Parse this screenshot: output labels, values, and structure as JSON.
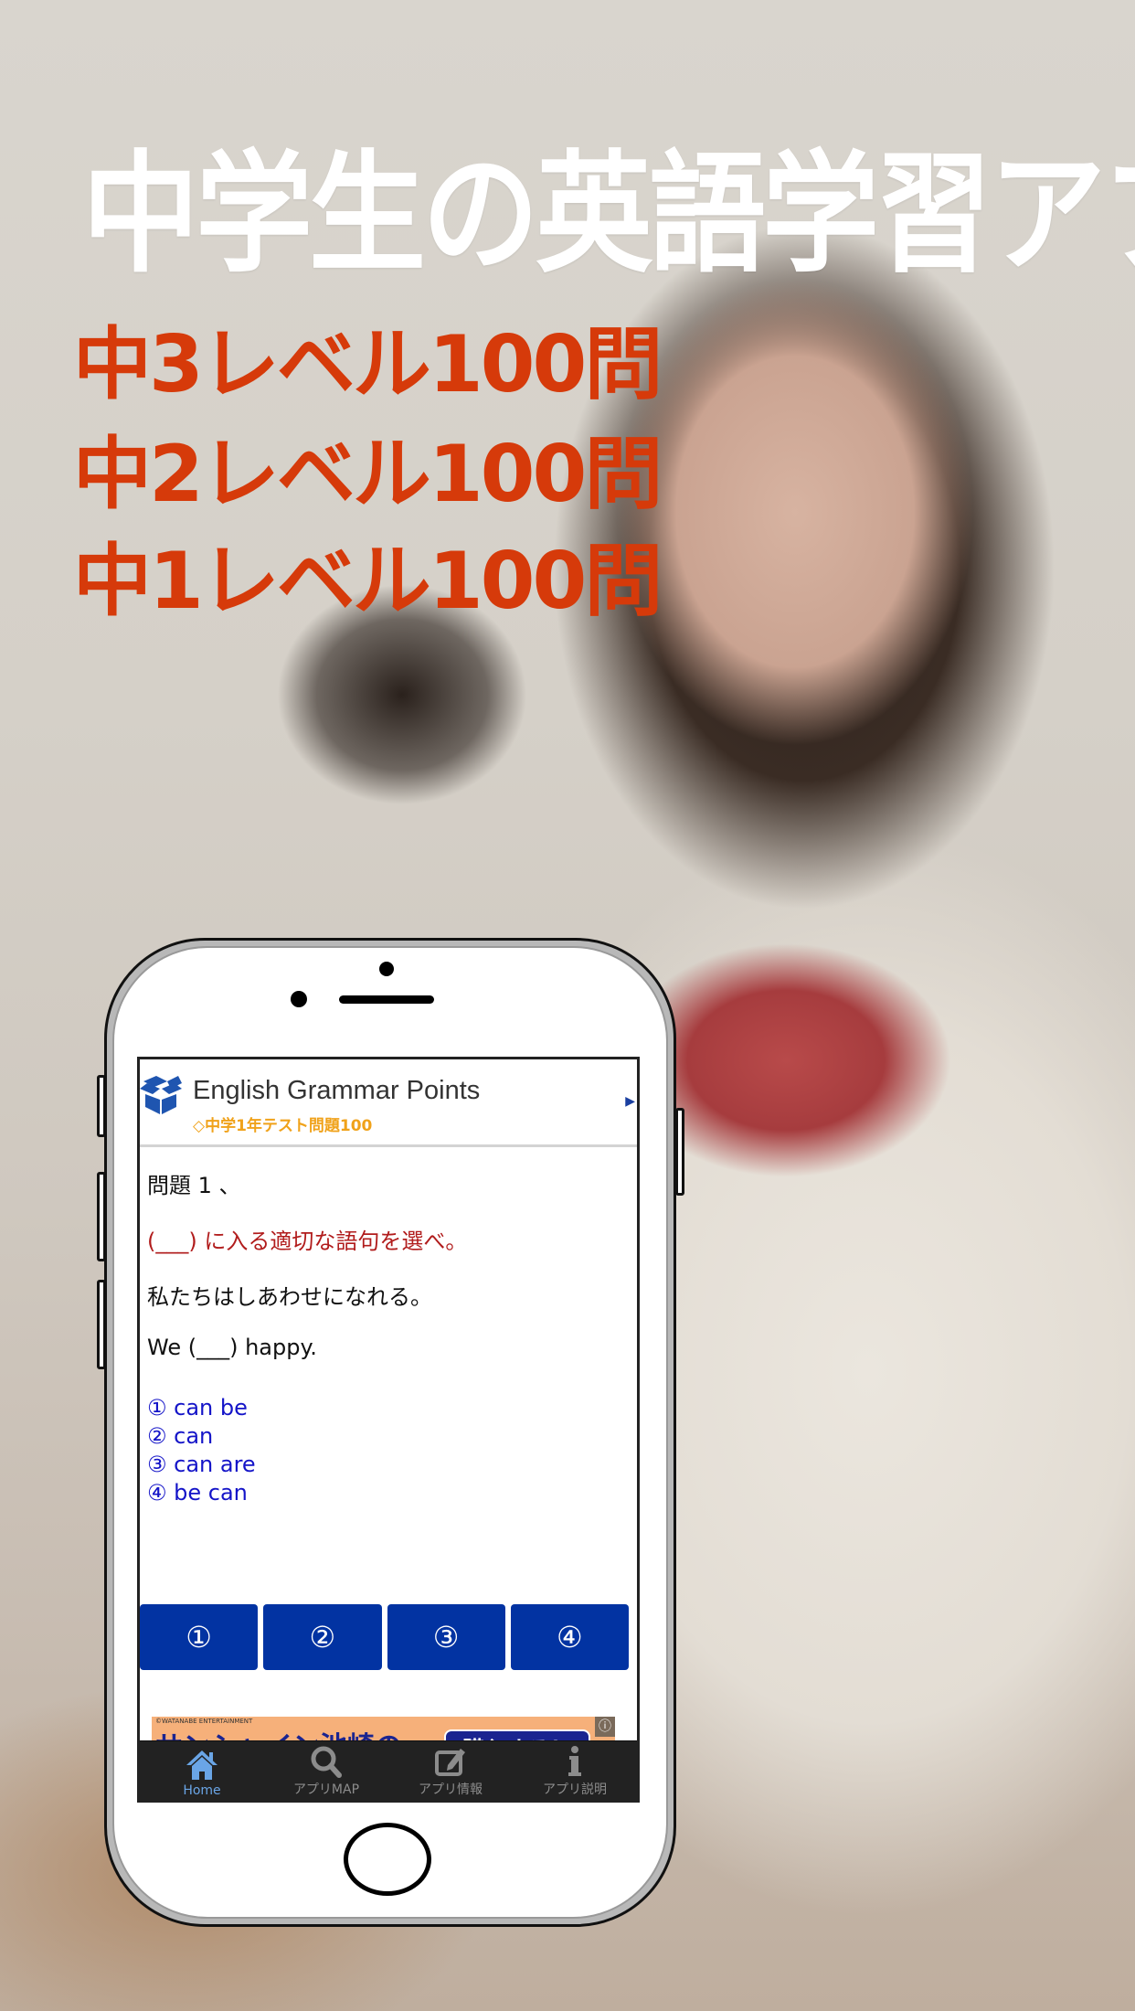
{
  "promo": {
    "headline": "中学生の英語学習アプリ",
    "levels": [
      "中3レベル100問",
      "中2レベル100問",
      "中1レベル100問"
    ],
    "headline_color": "#ffffff",
    "levels_color": "#d63a0a"
  },
  "app": {
    "logo_icon": "open-box-icon",
    "title": "English Grammar Points",
    "subtitle": "◇中学1年テスト問題100",
    "arrow_icon": "triangle-right-icon"
  },
  "question": {
    "title": "問題 1 、",
    "instruction": "(___) に入る適切な語句を選べ。",
    "japanese": "私たちはしあわせになれる。",
    "english": "We (___) happy.",
    "choices": [
      "① can be",
      "② can",
      "③ can are",
      "④ be can"
    ]
  },
  "answer_buttons": [
    "①",
    "②",
    "③",
    "④"
  ],
  "answer_button_color": "#0233a2",
  "ad": {
    "credit": "©WATANABE ENTERTAINMENT",
    "text": "サンシャイン池崎の",
    "cta": "購入する！",
    "info_icon": "ⓘ"
  },
  "tabbar": {
    "items": [
      {
        "label": "Home",
        "icon": "home-icon",
        "active": true
      },
      {
        "label": "アプリMAP",
        "icon": "search-icon",
        "active": false
      },
      {
        "label": "アプリ情報",
        "icon": "edit-icon",
        "active": false
      },
      {
        "label": "アプリ説明",
        "icon": "info-icon",
        "active": false
      }
    ],
    "active_color": "#6aa5e6"
  }
}
